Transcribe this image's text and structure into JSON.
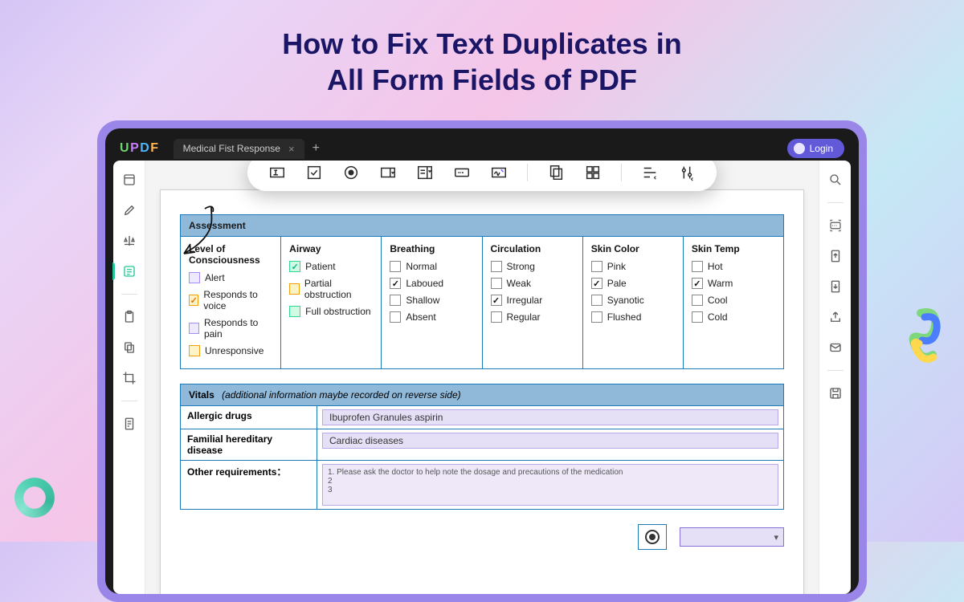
{
  "hero": {
    "line1": "How to Fix Text Duplicates in",
    "line2": "All Form Fields of PDF"
  },
  "app": {
    "logo": "UPDF",
    "tab_title": "Medical Fist Response",
    "login_label": "Login"
  },
  "assessment": {
    "header": "Assessment",
    "columns": [
      {
        "title": "Level of Consciousness",
        "items": [
          {
            "label": "Alert",
            "style": "purple",
            "checked": false
          },
          {
            "label": "Responds to voice",
            "style": "yellow",
            "checked": true
          },
          {
            "label": "Responds to pain",
            "style": "purple",
            "checked": false
          },
          {
            "label": "Unresponsive",
            "style": "yellow",
            "checked": false
          }
        ]
      },
      {
        "title": "Airway",
        "items": [
          {
            "label": "Patient",
            "style": "green",
            "checked": true
          },
          {
            "label": "Partial obstruction",
            "style": "yellow",
            "checked": false
          },
          {
            "label": "Full obstruction",
            "style": "green",
            "checked": false
          }
        ]
      },
      {
        "title": "Breathing",
        "items": [
          {
            "label": "Normal",
            "style": "plain",
            "checked": false
          },
          {
            "label": "Laboued",
            "style": "plain",
            "checked": true
          },
          {
            "label": "Shallow",
            "style": "plain",
            "checked": false
          },
          {
            "label": "Absent",
            "style": "plain",
            "checked": false
          }
        ]
      },
      {
        "title": "Circulation",
        "items": [
          {
            "label": "Strong",
            "style": "plain",
            "checked": false
          },
          {
            "label": "Weak",
            "style": "plain",
            "checked": false
          },
          {
            "label": "Irregular",
            "style": "plain",
            "checked": true
          },
          {
            "label": "Regular",
            "style": "plain",
            "checked": false
          }
        ]
      },
      {
        "title": "Skin Color",
        "items": [
          {
            "label": "Pink",
            "style": "plain",
            "checked": false
          },
          {
            "label": "Pale",
            "style": "plain",
            "checked": true
          },
          {
            "label": "Syanotic",
            "style": "plain",
            "checked": false
          },
          {
            "label": "Flushed",
            "style": "plain",
            "checked": false
          }
        ]
      },
      {
        "title": "Skin Temp",
        "items": [
          {
            "label": "Hot",
            "style": "plain",
            "checked": false
          },
          {
            "label": "Warm",
            "style": "plain",
            "checked": true
          },
          {
            "label": "Cool",
            "style": "plain",
            "checked": false
          },
          {
            "label": "Cold",
            "style": "plain",
            "checked": false
          }
        ]
      }
    ]
  },
  "vitals": {
    "header_b": "Vitals",
    "header_i": "(additional information maybe recorded on reverse side)",
    "allergic_label": "Allergic drugs",
    "allergic_value": "Ibuprofen Granules  aspirin",
    "familial_label": "Familial hereditary disease",
    "familial_value": "Cardiac diseases",
    "other_label": "Other requirements：",
    "other_lines": "1. Please ask the doctor to help note the dosage and precautions of the medication\n2\n3"
  }
}
